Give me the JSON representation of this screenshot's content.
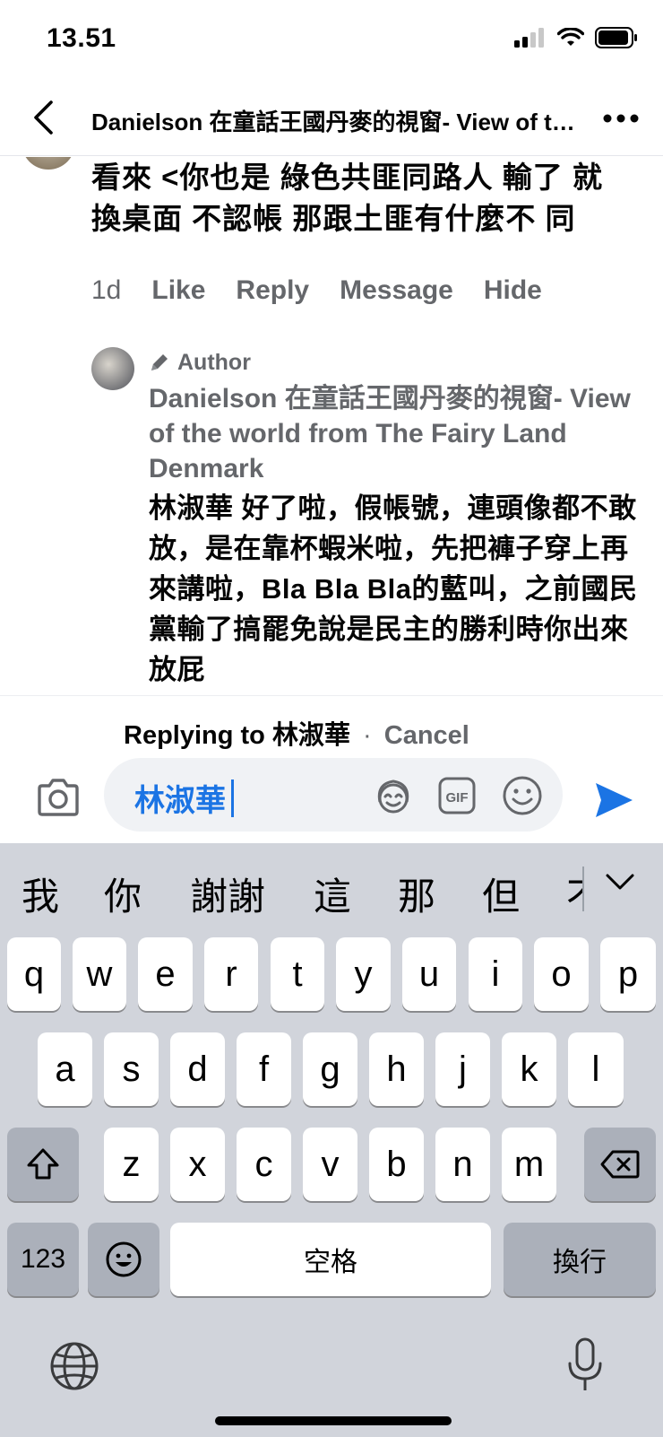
{
  "status": {
    "time": "13.51"
  },
  "header": {
    "title": "Danielson 在童話王國丹麥的視窗- View of the world from The Fairy Land Denmark",
    "back_icon": "chevron-left-icon",
    "more_icon": "more-horizontal-icon"
  },
  "comment": {
    "text": "看來 <你也是 綠色共匪同路人 輸了 就 換桌面 不認帳 那跟土匪有什麼不 同",
    "time": "1d",
    "actions": [
      "Like",
      "Reply",
      "Message",
      "Hide"
    ]
  },
  "reply": {
    "badge": "Author",
    "name": "Danielson 在童話王國丹麥的視窗- View of the world from The Fairy Land Denmark",
    "text": "林淑華 好了啦，假帳號，連頭像都不敢放，是在靠杯蝦米啦，先把褲子穿上再來講啦，Bla Bla Bla的藍叫，之前國民黨輸了搞罷免說是民主的勝利時你出來放屁"
  },
  "replying": {
    "label": "Replying to 林淑華",
    "separator": "·",
    "cancel": "Cancel"
  },
  "composer": {
    "value": "林淑華",
    "icons": [
      "camera-icon",
      "avatar-sticker-icon",
      "gif-icon",
      "emoji-icon",
      "send-icon"
    ],
    "accent": "#1b74e4"
  },
  "keyboard": {
    "candidates": [
      "我",
      "你",
      "謝謝",
      "這",
      "那",
      "但",
      "不"
    ],
    "row1": [
      "q",
      "w",
      "e",
      "r",
      "t",
      "y",
      "u",
      "i",
      "o",
      "p"
    ],
    "row2": [
      "a",
      "s",
      "d",
      "f",
      "g",
      "h",
      "j",
      "k",
      "l"
    ],
    "row3": [
      "z",
      "x",
      "c",
      "v",
      "b",
      "n",
      "m"
    ],
    "numbers_label": "123",
    "space_label": "空格",
    "return_label": "換行"
  }
}
